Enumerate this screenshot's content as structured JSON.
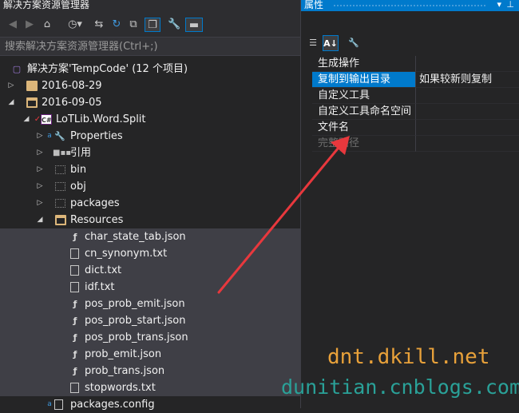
{
  "solution_explorer": {
    "title": "解决方案资源管理器",
    "search_placeholder": "搜索解决方案资源管理器(Ctrl+;)",
    "toolbar_icons": [
      "back-icon",
      "forward-icon",
      "home-icon",
      "history-icon",
      "sync-icon",
      "refresh-icon",
      "collapse-all-icon",
      "show-all-files-icon",
      "properties-wrench-icon",
      "preview-icon"
    ],
    "tree": [
      {
        "label": "解决方案'TempCode' (12 个项目)",
        "icon": "solution-icon"
      },
      {
        "label": "2016-08-29",
        "icon": "folder-icon"
      },
      {
        "label": "2016-09-05",
        "icon": "folder-open-icon"
      },
      {
        "label": "LoTLib.Word.Split",
        "icon": "csharp-project-icon"
      },
      {
        "label": "Properties",
        "icon": "wrench-icon"
      },
      {
        "label": "引用",
        "icon": "references-icon"
      },
      {
        "label": "bin",
        "icon": "hidden-folder-icon"
      },
      {
        "label": "obj",
        "icon": "hidden-folder-icon"
      },
      {
        "label": "packages",
        "icon": "hidden-folder-icon"
      },
      {
        "label": "Resources",
        "icon": "folder-open-icon"
      },
      {
        "label": "char_state_tab.json",
        "icon": "json-file-icon"
      },
      {
        "label": "cn_synonym.txt",
        "icon": "text-file-icon"
      },
      {
        "label": "dict.txt",
        "icon": "text-file-icon"
      },
      {
        "label": "idf.txt",
        "icon": "text-file-icon"
      },
      {
        "label": "pos_prob_emit.json",
        "icon": "json-file-icon"
      },
      {
        "label": "pos_prob_start.json",
        "icon": "json-file-icon"
      },
      {
        "label": "pos_prob_trans.json",
        "icon": "json-file-icon"
      },
      {
        "label": "prob_emit.json",
        "icon": "json-file-icon"
      },
      {
        "label": "prob_trans.json",
        "icon": "json-file-icon"
      },
      {
        "label": "stopwords.txt",
        "icon": "text-file-icon"
      },
      {
        "label": "packages.config",
        "icon": "config-file-icon"
      }
    ]
  },
  "properties": {
    "title": "属性",
    "toolbar_icons": [
      "categorized-icon",
      "alphabetical-icon",
      "property-pages-icon"
    ],
    "rows": [
      {
        "name": "生成操作",
        "value": ""
      },
      {
        "name": "复制到输出目录",
        "value": "如果较新则复制"
      },
      {
        "name": "自定义工具",
        "value": ""
      },
      {
        "name": "自定义工具命名空间",
        "value": ""
      },
      {
        "name": "文件名",
        "value": ""
      },
      {
        "name": "完整路径",
        "value": ""
      }
    ]
  },
  "watermark": {
    "line1": "dnt.dkill.net",
    "line2": "dunitian.cnblogs.com"
  },
  "colors": {
    "accent": "#007acc",
    "arrow": "#e8383d",
    "watermark1": "#e8a13a",
    "watermark2": "#2aa198"
  }
}
